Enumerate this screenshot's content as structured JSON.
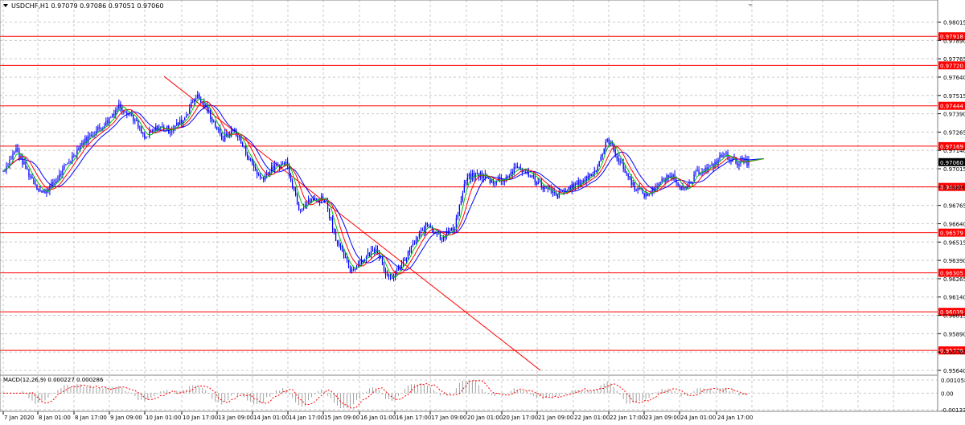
{
  "header": {
    "symbol_info": "USDCHF,H1  0.97079 0.97086 0.97051 0.97060"
  },
  "macd": {
    "label": "MACD(12,26,9) 0.000227 0.000286",
    "scale_labels": [
      "0.001058",
      "0.00",
      "-0.001336"
    ],
    "ymax": 0.001058,
    "ymin": -0.001336
  },
  "colors": {
    "background": "#ffffff",
    "grid": "#c8c8c8",
    "candles": "#0000ff",
    "levels": "#ff0000",
    "ma_fast": "#00c000",
    "ma_mid": "#ff0000",
    "ma_slow": "#0000ff",
    "price_tag": "#000000"
  },
  "chart_data": {
    "type": "candlestick",
    "symbol": "USDCHF",
    "timeframe": "H1",
    "ylim": [
      0.9564,
      0.981
    ],
    "y_ticks": [
      "0.98015",
      "0.97890",
      "0.97765",
      "0.97640",
      "0.97515",
      "0.97390",
      "0.97265",
      "0.97140",
      "0.97015",
      "0.96890",
      "0.96765",
      "0.96640",
      "0.96515",
      "0.96390",
      "0.96265",
      "0.96140",
      "0.96015",
      "0.95890",
      "0.95765",
      "0.95640"
    ],
    "x_ticks": [
      "7 Jan 2020",
      "8 Jan 01:00",
      "8 Jan 17:00",
      "9 Jan 09:00",
      "10 Jan 01:00",
      "10 Jan 17:00",
      "13 Jan 09:00",
      "14 Jan 01:00",
      "14 Jan 17:00",
      "15 Jan 09:00",
      "16 Jan 01:00",
      "16 Jan 17:00",
      "17 Jan 09:00",
      "20 Jan 01:00",
      "20 Jan 17:00",
      "21 Jan 09:00",
      "22 Jan 01:00",
      "22 Jan 17:00",
      "23 Jan 09:00",
      "24 Jan 01:00",
      "24 Jan 17:00"
    ],
    "current_price": "0.97060",
    "levels": [
      "0.97918",
      "0.97720",
      "0.97444",
      "0.97169",
      "0.96891",
      "0.96579",
      "0.96305",
      "0.96039",
      "0.95776"
    ],
    "close_path": [
      0.97,
      0.9715,
      0.9698,
      0.9685,
      0.9692,
      0.9705,
      0.9718,
      0.9726,
      0.9733,
      0.9745,
      0.9738,
      0.9722,
      0.973,
      0.9728,
      0.9735,
      0.9752,
      0.974,
      0.9722,
      0.9728,
      0.971,
      0.9695,
      0.9702,
      0.9706,
      0.9675,
      0.968,
      0.9682,
      0.965,
      0.9632,
      0.964,
      0.9648,
      0.9625,
      0.9636,
      0.9652,
      0.9664,
      0.9655,
      0.966,
      0.9695,
      0.9698,
      0.9693,
      0.9695,
      0.9703,
      0.9697,
      0.9689,
      0.9683,
      0.9688,
      0.9693,
      0.97,
      0.9722,
      0.9705,
      0.969,
      0.9683,
      0.9692,
      0.9697,
      0.9686,
      0.97,
      0.9702,
      0.9712,
      0.9706,
      0.9706
    ],
    "trendline": [
      0.97645,
      0.9564
    ]
  }
}
